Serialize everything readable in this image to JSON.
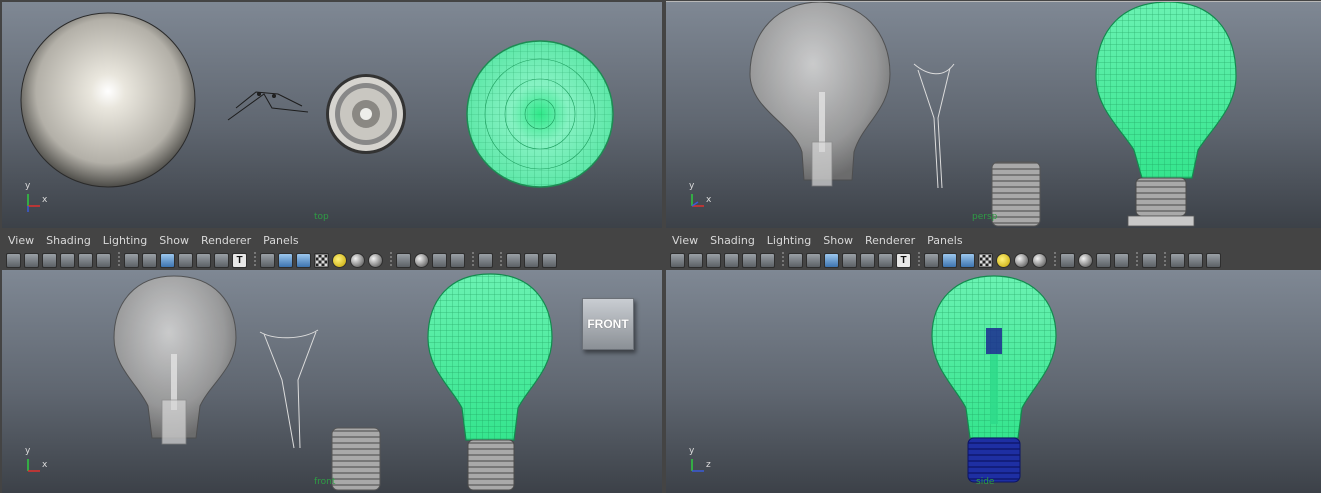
{
  "menu": [
    "View",
    "Shading",
    "Lighting",
    "Show",
    "Renderer",
    "Panels"
  ],
  "toolbar_icons": [
    "select-camera-icon",
    "camera-attributes-icon",
    "bookmarks-icon",
    "image-plane-icon",
    "2d-pan-zoom-icon",
    "grease-pencil-icon",
    "|",
    "grid-icon",
    "film-gate-icon",
    "resolution-gate-icon",
    "gate-mask-icon",
    "field-chart-icon",
    "safe-action-icon",
    "safe-title-icon",
    "|",
    "wireframe-icon",
    "smooth-shade-icon",
    "wireframe-on-shaded-icon",
    "textured-icon",
    "use-all-lights-icon",
    "shadows-icon",
    "screen-space-ao-icon",
    "|",
    "motion-blur-icon",
    "anti-aliasing-icon",
    "depth-of-field-icon",
    "xray-icon",
    "|",
    "isolate-select-icon",
    "|",
    "xray-joints-icon",
    "xray-active-icon",
    "backface-culling-icon"
  ],
  "viewports": {
    "top": {
      "camera": "top",
      "axis": [
        "y",
        "x"
      ]
    },
    "persp": {
      "camera": "persp",
      "axis": [
        "y",
        "x"
      ]
    },
    "front": {
      "camera": "front",
      "axis": [
        "y",
        "x"
      ],
      "view_cube_label": "FRONT"
    },
    "side": {
      "camera": "side",
      "axis": [
        "y",
        "z"
      ]
    }
  },
  "colors": {
    "wireframe": "#3df29a",
    "selected_base": "#1b2a8f",
    "ui_bg": "#444444"
  }
}
